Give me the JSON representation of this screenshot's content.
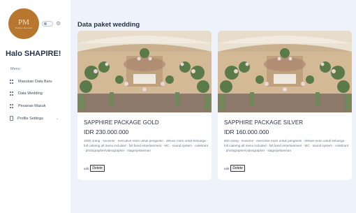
{
  "logo": {
    "monogram": "PM",
    "tagline": "Perfect Moment"
  },
  "sidebar": {
    "greeting": "Halo SHAPIRE!",
    "menu_label": "Menu",
    "items": [
      {
        "label": "Masukan Data Baru",
        "icon": "grid-icon"
      },
      {
        "label": "Data Wedding",
        "icon": "grid-icon"
      },
      {
        "label": "Pesanan Masuk",
        "icon": "grid-icon"
      },
      {
        "label": "Profile Settings",
        "icon": "document-icon",
        "chevron": "⌄"
      }
    ]
  },
  "main": {
    "title": "Data paket wedding",
    "cards": [
      {
        "title": "SAPPHIRE PACKAGE GOLD",
        "price": "IDR 230.000.000",
        "description": "1000 orang · souvenir · executive room untuk pengantin · deluxe room untuk keluarga · full catering all menu included · full band entertainment · MC · sound system · celebrant · photographer/videographer · stage/pelaminan",
        "edit_label": "edit",
        "delete_label": "Delete"
      },
      {
        "title": "SAPPHIRE PACKAGE SILVER",
        "price": "IDR 160.000.000",
        "description": "600 orang · souvenir · executive room untuk pengantin · deluxe room untuk keluarga · full catering all menu included · full band entertainment · MC · sound system · celebrant · photographer/videographer · stage/pelaminan",
        "edit_label": "edit",
        "delete_label": "Delete"
      }
    ]
  },
  "colors": {
    "background": "#eef2fa",
    "logo": "#b8762f",
    "text": "#2b3447"
  }
}
